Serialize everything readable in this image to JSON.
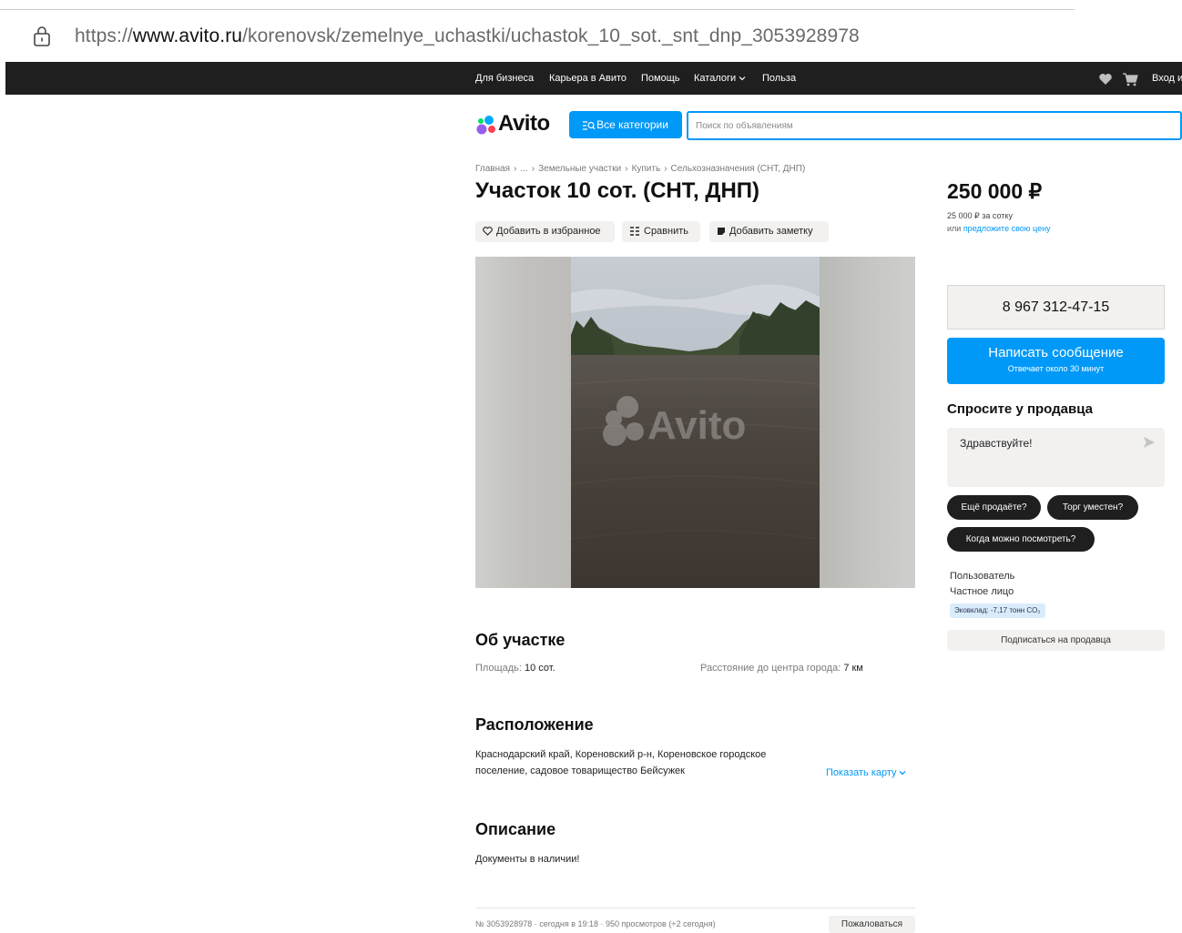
{
  "browser": {
    "url_scheme": "https://",
    "url_host": "www.avito.ru",
    "url_path": "/korenovsk/zemelnye_uchastki/uchastok_10_sot._snt_dnp_3053928978"
  },
  "topnav": {
    "links": [
      "Для бизнеса",
      "Карьера в Авито",
      "Помощь",
      "Каталоги",
      "Польза"
    ],
    "login": "Вход и"
  },
  "header": {
    "logo": "Avito",
    "categories_button": "Все категории",
    "search_placeholder": "Поиск по объявлениям"
  },
  "breadcrumbs": [
    "Главная",
    "...",
    "Земельные участки",
    "Купить",
    "Сельхозназначения (СНТ, ДНП)"
  ],
  "listing": {
    "title": "Участок 10 сот. (СНТ, ДНП)",
    "actions": {
      "favorite": "Добавить в избранное",
      "compare": "Сравнить",
      "note": "Добавить заметку"
    },
    "photo_watermark": "Avito",
    "about": {
      "heading": "Об участке",
      "area_label": "Площадь:",
      "area_value": "10 сот.",
      "distance_label": "Расстояние до центра города:",
      "distance_value": "7 км"
    },
    "location": {
      "heading": "Расположение",
      "address_line1": "Краснодарский край, Кореновский р-н, Кореновское городское",
      "address_line2": "поселение, садовое товарищество Бейсужек",
      "show_map": "Показать карту"
    },
    "description": {
      "heading": "Описание",
      "text": "Документы в наличии!"
    },
    "meta": "№ 3053928978 · сегодня в 19:18 · 950 просмотров (+2 сегодня)",
    "complain": "Пожаловаться"
  },
  "sidebar": {
    "price": "250 000 ₽",
    "price_per": "25 000 ₽ за сотку",
    "offer_prefix": "или ",
    "offer_link": "предложите свою цену",
    "phone": "8 967 312-47-15",
    "message_button": "Написать сообщение",
    "message_sub": "Отвечает около 30 минут",
    "ask_heading": "Спросите у продавца",
    "ask_default": "Здравствуйте!",
    "chips": [
      "Ещё продаёте?",
      "Торг уместен?",
      "Когда можно посмотреть?"
    ],
    "seller_role": "Пользователь",
    "seller_type": "Частное лицо",
    "eco": "Эковклад: -7,17 тонн CO₂",
    "subscribe": "Подписаться на продавца"
  },
  "colors": {
    "accent": "#0099f7",
    "nav_bg": "#1f1f1f",
    "chip_bg": "#1f1f1f",
    "panel_bg": "#f2f1f0"
  }
}
